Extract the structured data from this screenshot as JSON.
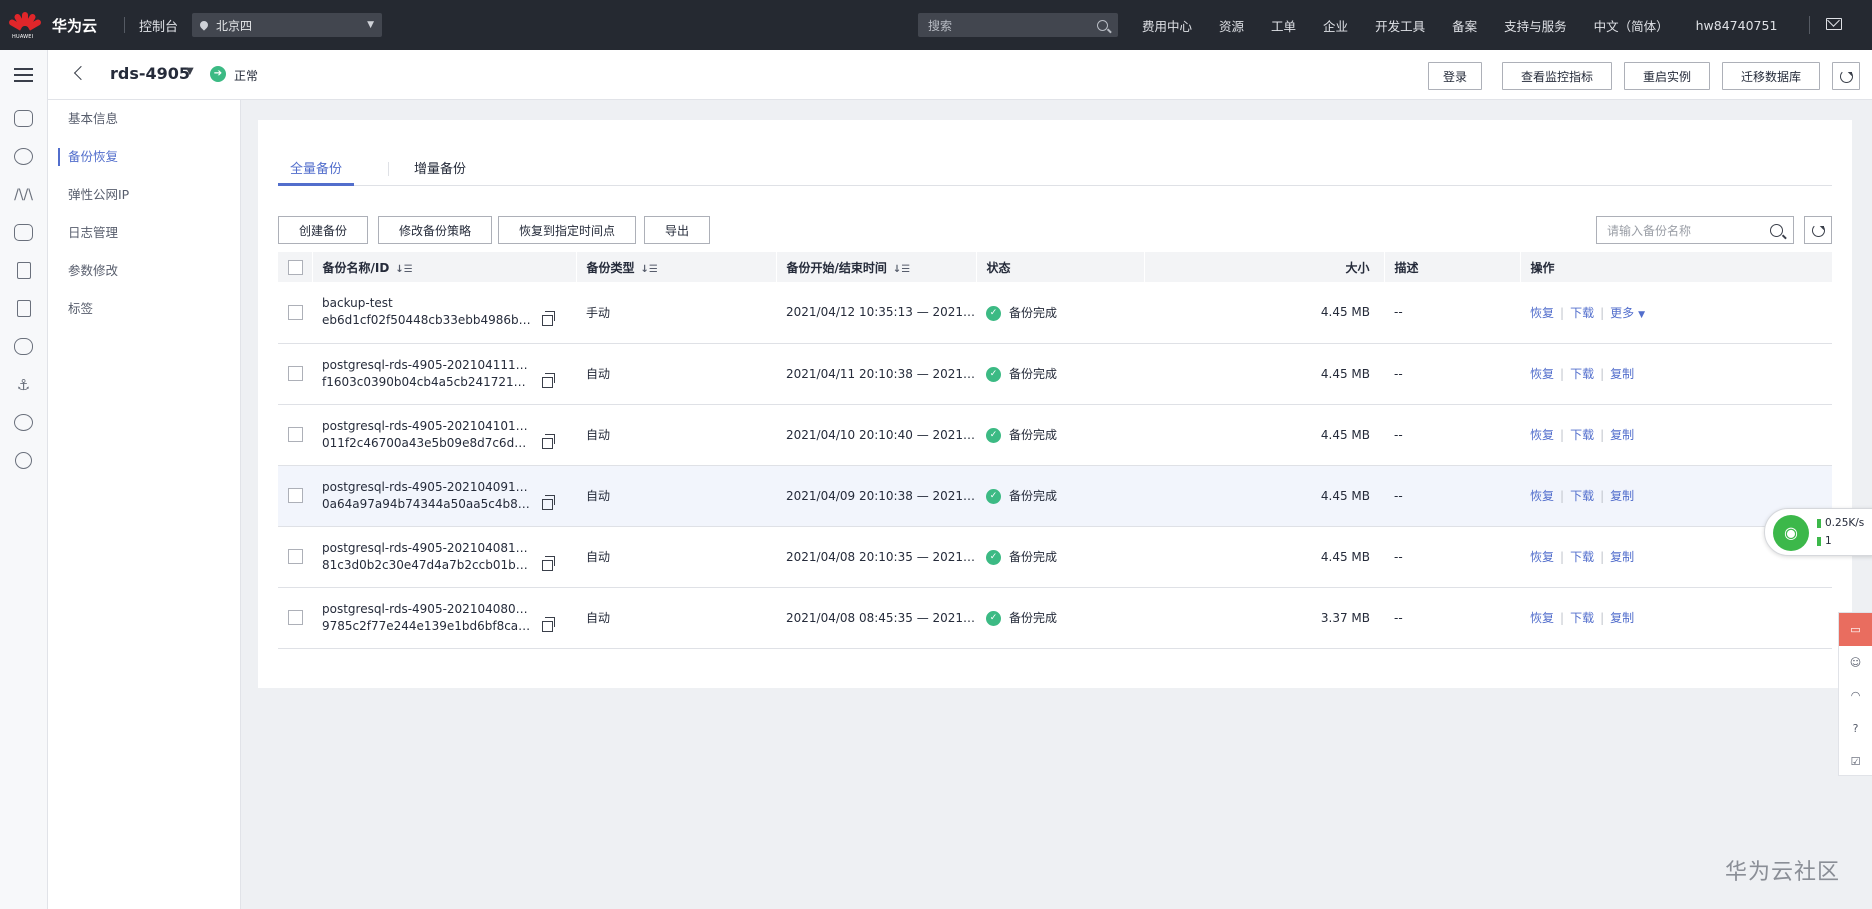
{
  "topbar": {
    "logo_text": "HUAWEI",
    "brand": "华为云",
    "console": "控制台",
    "region": "北京四",
    "search_placeholder": "搜索",
    "nav": [
      "费用中心",
      "资源",
      "工单",
      "企业",
      "开发工具",
      "备案",
      "支持与服务",
      "中文（简体）",
      "hw84740751"
    ]
  },
  "header": {
    "instance_name": "rds-4905",
    "status": "正常",
    "buttons": [
      "登录",
      "查看监控指标",
      "重启实例",
      "迁移数据库"
    ]
  },
  "subnav": {
    "items": [
      "基本信息",
      "备份恢复",
      "弹性公网IP",
      "日志管理",
      "参数修改",
      "标签"
    ],
    "active_index": 1
  },
  "tabs": [
    "全量备份",
    "增量备份"
  ],
  "actions": [
    "创建备份",
    "修改备份策略",
    "恢复到指定时间点",
    "导出"
  ],
  "filter": {
    "placeholder": "请输入备份名称"
  },
  "table": {
    "columns": [
      "备份名称/ID",
      "备份类型",
      "备份开始/结束时间",
      "状态",
      "大小",
      "描述",
      "操作"
    ],
    "rows": [
      {
        "name": "backup-test",
        "id": "eb6d1cf02f50448cb33ebb4986bd0a...",
        "type": "手动",
        "time": "2021/04/12 10:35:13 — 2021/0...",
        "status": "备份完成",
        "size": "4.45 MB",
        "desc": "--",
        "ops": [
          "恢复",
          "下载",
          "更多"
        ]
      },
      {
        "name": "postgresql-rds-4905-202104111210...",
        "id": "f1603c0390b04cb4a5cb2417219cc1...",
        "type": "自动",
        "time": "2021/04/11 20:10:38 — 2021/0...",
        "status": "备份完成",
        "size": "4.45 MB",
        "desc": "--",
        "ops": [
          "恢复",
          "下载",
          "复制"
        ]
      },
      {
        "name": "postgresql-rds-4905-202104101210...",
        "id": "011f2c46700a43e5b09e8d7c6d1f1b...",
        "type": "自动",
        "time": "2021/04/10 20:10:40 — 2021/0...",
        "status": "备份完成",
        "size": "4.45 MB",
        "desc": "--",
        "ops": [
          "恢复",
          "下载",
          "复制"
        ]
      },
      {
        "name": "postgresql-rds-4905-202104091210...",
        "id": "0a64a97a94b74344a50aa5c4b83f2b...",
        "type": "自动",
        "time": "2021/04/09 20:10:38 — 2021/0...",
        "status": "备份完成",
        "size": "4.45 MB",
        "desc": "--",
        "ops": [
          "恢复",
          "下载",
          "复制"
        ]
      },
      {
        "name": "postgresql-rds-4905-202104081210...",
        "id": "81c3d0b2c30e47d4a7b2ccb01b47f7...",
        "type": "自动",
        "time": "2021/04/08 20:10:35 — 2021/0...",
        "status": "备份完成",
        "size": "4.45 MB",
        "desc": "--",
        "ops": [
          "恢复",
          "下载",
          "复制"
        ]
      },
      {
        "name": "postgresql-rds-4905-202104080045...",
        "id": "9785c2f77e244e139e1bd6bf8ca594...",
        "type": "自动",
        "time": "2021/04/08 08:45:35 — 2021/0...",
        "status": "备份完成",
        "size": "3.37 MB",
        "desc": "--",
        "ops": [
          "恢复",
          "下载",
          "复制"
        ]
      }
    ]
  },
  "net_widget": {
    "speed": "0.25K/s",
    "count": "1"
  },
  "watermark": "华为云社区"
}
